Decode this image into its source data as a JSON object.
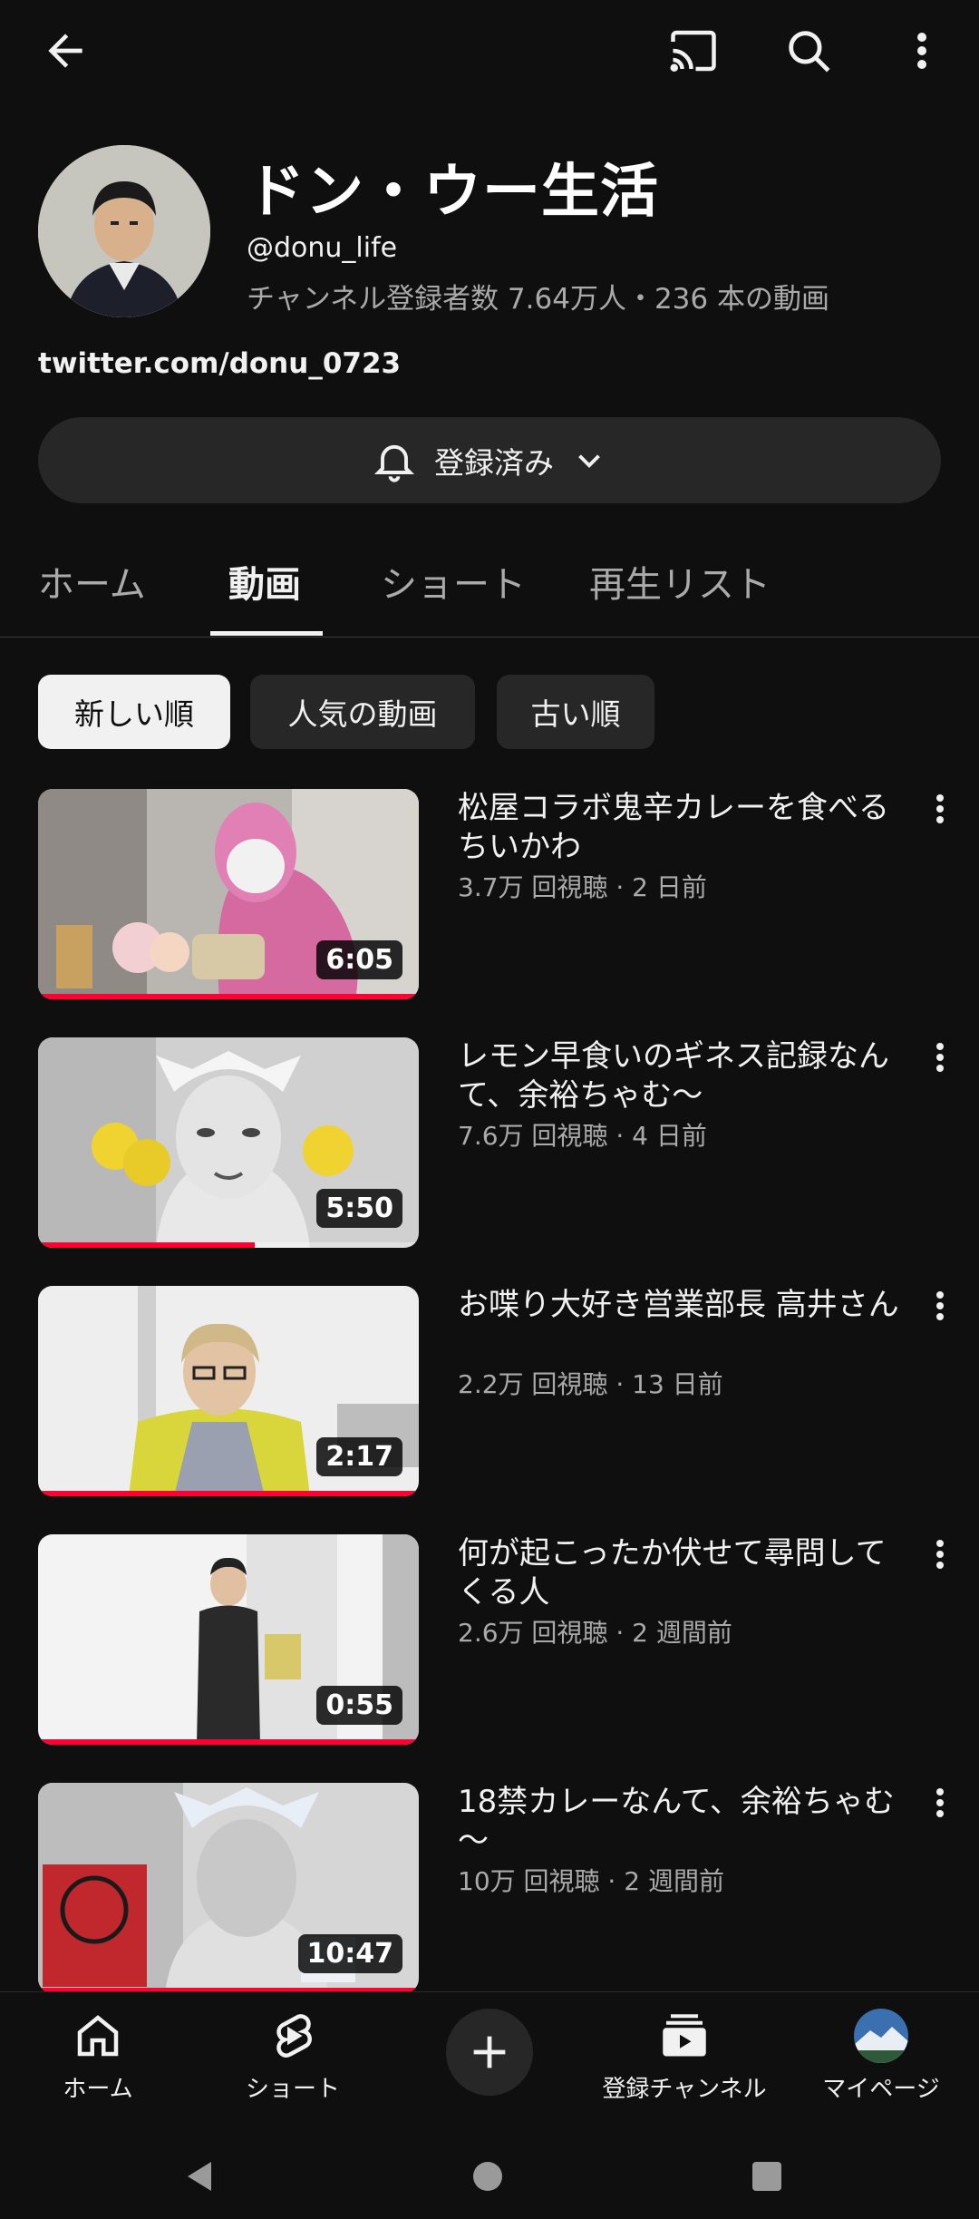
{
  "channel": {
    "name": "ドン・ウー生活",
    "handle": "@donu_life",
    "stats": "チャンネル登録者数 7.64万人・236 本の動画",
    "link": "twitter.com/donu_0723",
    "subscribe_label": "登録済み"
  },
  "tabs": [
    {
      "label": "ホーム",
      "active": false
    },
    {
      "label": "動画",
      "active": true
    },
    {
      "label": "ショート",
      "active": false
    },
    {
      "label": "再生リスト",
      "active": false
    }
  ],
  "chips": [
    {
      "label": "新しい順",
      "selected": true
    },
    {
      "label": "人気の動画",
      "selected": false
    },
    {
      "label": "古い順",
      "selected": false
    }
  ],
  "videos": [
    {
      "title": "松屋コラボ鬼辛カレーを食べるちいかわ",
      "meta": "3.7万 回視聴 · 2 日前",
      "duration": "6:05",
      "progress": 1.0
    },
    {
      "title": "レモン早食いのギネス記録なんて、余裕ちゃむ～",
      "meta": "7.6万 回視聴 · 4 日前",
      "duration": "5:50",
      "progress": 0.57
    },
    {
      "title": "お喋り大好き営業部長 高井さん",
      "meta": "2.2万 回視聴 · 13 日前",
      "duration": "2:17",
      "progress": 1.0
    },
    {
      "title": "何が起こったか伏せて尋問してくる人",
      "meta": "2.6万 回視聴 · 2 週間前",
      "duration": "0:55",
      "progress": 1.0
    },
    {
      "title": "18禁カレーなんて、余裕ちゃむ～",
      "meta": "10万 回視聴 · 2 週間前",
      "duration": "10:47",
      "progress": 1.0
    }
  ],
  "bottom_nav": {
    "home": "ホーム",
    "shorts": "ショート",
    "subscriptions": "登録チャンネル",
    "mypage": "マイページ"
  },
  "colors": {
    "background": "#0f0f0f",
    "accent_red": "#ff0033",
    "chip_bg": "#272727"
  }
}
